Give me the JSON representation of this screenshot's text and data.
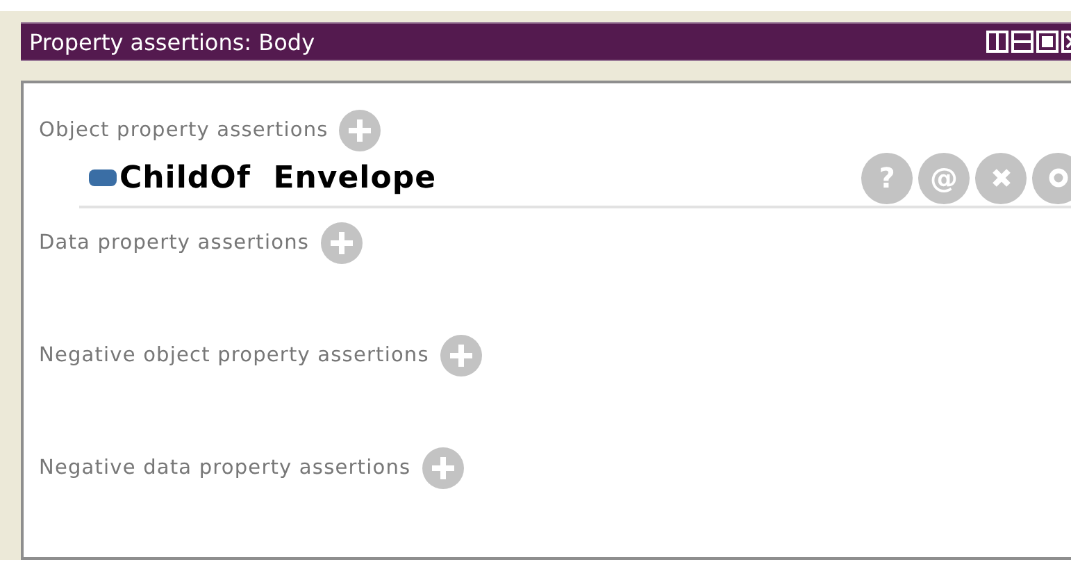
{
  "window": {
    "title": "Property assertions: Body"
  },
  "sections": [
    {
      "label": "Object property assertions",
      "entries": [
        {
          "property": "ChildOf",
          "value": "Envelope",
          "actions": [
            {
              "kind": "text",
              "label": "?"
            },
            {
              "kind": "text",
              "label": "@"
            },
            {
              "kind": "delete"
            },
            {
              "kind": "edit"
            }
          ]
        }
      ]
    },
    {
      "label": "Data property assertions"
    },
    {
      "label": "Negative object property assertions"
    },
    {
      "label": "Negative data property assertions"
    }
  ]
}
